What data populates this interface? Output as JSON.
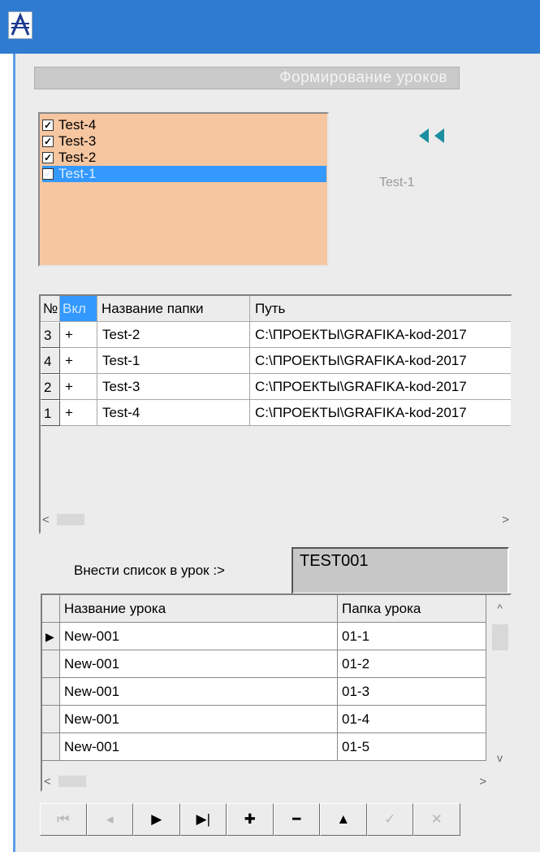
{
  "window": {
    "title_bar_color": "#2e7bd1",
    "icon": "app-logo-icon",
    "header_title": "Формирование уроков"
  },
  "folder_checklist": {
    "background": "#f6c6a0",
    "items": [
      {
        "label": "Test-4",
        "checked": true,
        "selected": false
      },
      {
        "label": "Test-3",
        "checked": true,
        "selected": false
      },
      {
        "label": "Test-2",
        "checked": true,
        "selected": false
      },
      {
        "label": "Test-1",
        "checked": true,
        "selected": true
      }
    ]
  },
  "move_button": {
    "icon": "double-arrow-left-icon"
  },
  "current_folder_label": "Test-1",
  "folders_grid": {
    "columns": [
      "№",
      "Вкл",
      "Название папки",
      "Путь"
    ],
    "rows": [
      {
        "num": "3",
        "on": "+",
        "name": "Test-2",
        "path": "C:\\ПРОЕКТЫ\\GRAFIKA-kod-2017"
      },
      {
        "num": "4",
        "on": "+",
        "name": "Test-1",
        "path": "C:\\ПРОЕКТЫ\\GRAFIKA-kod-2017"
      },
      {
        "num": "2",
        "on": "+",
        "name": "Test-3",
        "path": "C:\\ПРОЕКТЫ\\GRAFIKA-kod-2017"
      },
      {
        "num": "1",
        "on": "+",
        "name": "Test-4",
        "path": "C:\\ПРОЕКТЫ\\GRAFIKA-kod-2017"
      }
    ],
    "scroll_left": "<",
    "scroll_right": ">"
  },
  "insert_list_label": "Внести список в урок :>",
  "lesson_field_value": "TEST001",
  "lessons_grid": {
    "columns": [
      "Название урока",
      "Папка урока"
    ],
    "rows": [
      {
        "current": true,
        "name": "New-001",
        "folder": "01-1"
      },
      {
        "current": false,
        "name": "New-001",
        "folder": "01-2"
      },
      {
        "current": false,
        "name": "New-001",
        "folder": "01-3"
      },
      {
        "current": false,
        "name": "New-001",
        "folder": "01-4"
      },
      {
        "current": false,
        "name": "New-001",
        "folder": "01-5"
      }
    ],
    "row_indicator": "▶",
    "scroll_up": "^",
    "scroll_down": "v",
    "scroll_left": "<",
    "scroll_right": ">"
  },
  "navigator": {
    "buttons": [
      {
        "name": "first-record",
        "glyph": "⏮",
        "enabled": false
      },
      {
        "name": "prior-record",
        "glyph": "◂",
        "enabled": false
      },
      {
        "name": "next-record",
        "glyph": "▶",
        "enabled": true
      },
      {
        "name": "last-record",
        "glyph": "▶|",
        "enabled": true
      },
      {
        "name": "insert-record",
        "glyph": "✚",
        "enabled": true
      },
      {
        "name": "delete-record",
        "glyph": "━",
        "enabled": true
      },
      {
        "name": "edit-record",
        "glyph": "▲",
        "enabled": true
      },
      {
        "name": "post-record",
        "glyph": "✓",
        "enabled": false
      },
      {
        "name": "cancel-record",
        "glyph": "✕",
        "enabled": false
      }
    ]
  }
}
